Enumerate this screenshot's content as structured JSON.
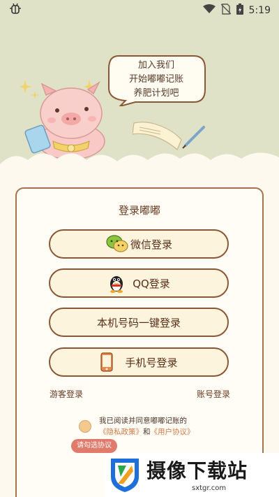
{
  "status_bar": {
    "app_icon": "bug-icon",
    "time": "5:19",
    "icons": [
      "wifi-icon",
      "no-sim-icon",
      "battery-icon"
    ]
  },
  "hero": {
    "bubble_lines": [
      "加入我们",
      "开始嘟嘟记账",
      "养肥计划吧"
    ],
    "bg_color": "#dfe2c6"
  },
  "card": {
    "title": "登录嘟嘟",
    "buttons": [
      {
        "label": "微信登录",
        "icon": "wechat-icon"
      },
      {
        "label": "QQ登录",
        "icon": "qq-penguin-icon"
      },
      {
        "label": "本机号码一键登录",
        "icon": ""
      },
      {
        "label": "手机号登录",
        "icon": "phone-icon"
      }
    ],
    "guest_login": "游客登录",
    "account_login": "账号登录",
    "agreement": {
      "line1": "我已阅读并同意嘟嘟记账的",
      "privacy": "《隐私政策》",
      "and": "和",
      "user_agreement": "《用户协议》"
    },
    "tooltip": "请勾选协议"
  },
  "watermark": {
    "title": "摄像下载站",
    "url": "sxtgr.com"
  },
  "colors": {
    "accent": "#8a5636",
    "button_fill": "#fdf4de",
    "link": "#d27a45",
    "tooltip": "#e07a6a"
  }
}
